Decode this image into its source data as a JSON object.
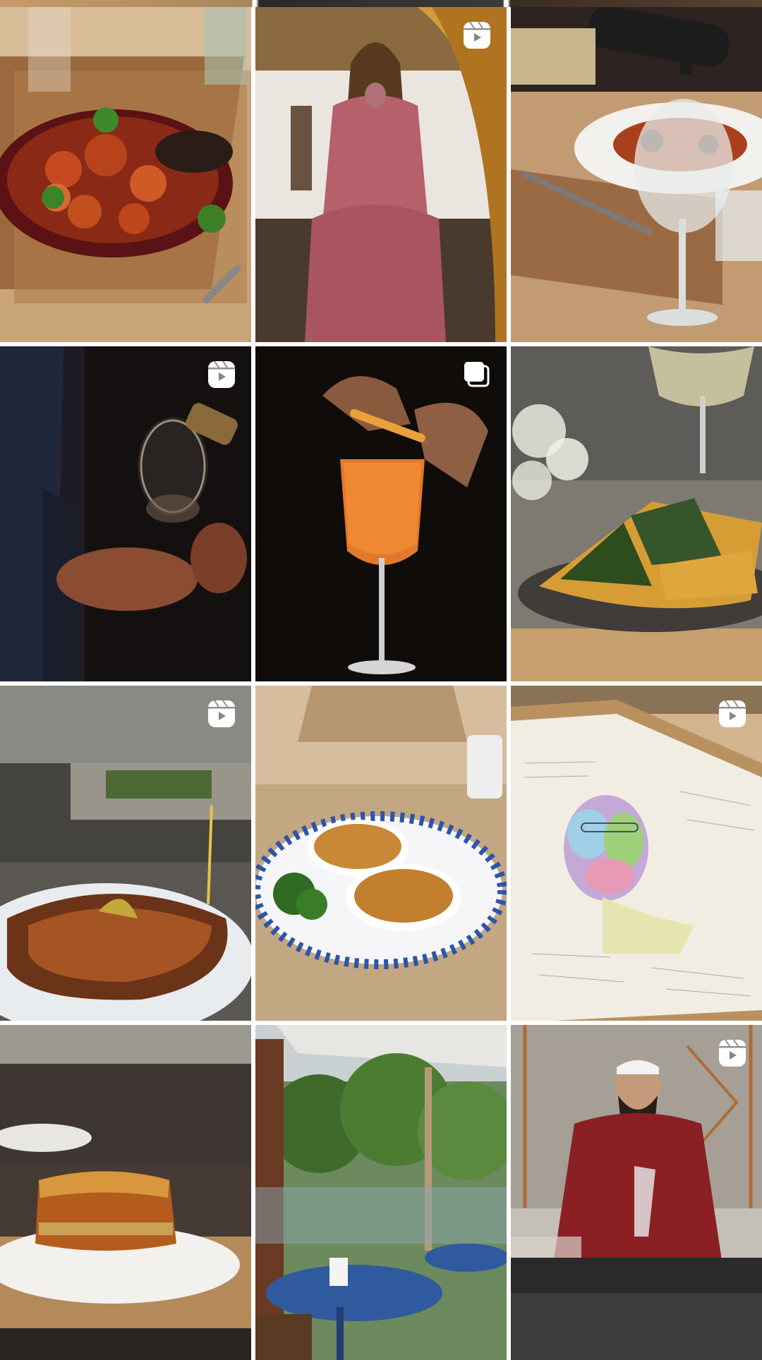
{
  "profile_grid": {
    "posts": [
      {
        "id": 1,
        "subject": "seafood-skillet",
        "type": "photo",
        "badge_icon": null
      },
      {
        "id": 2,
        "subject": "woman-pink-dress",
        "type": "reel",
        "badge_icon": "reel-icon"
      },
      {
        "id": 3,
        "subject": "wine-pour-pasta",
        "type": "photo",
        "badge_icon": null
      },
      {
        "id": 4,
        "subject": "wine-glass-pour",
        "type": "reel",
        "badge_icon": "reel-icon"
      },
      {
        "id": 5,
        "subject": "orange-spritz-cocktail",
        "type": "carousel",
        "badge_icon": "carousel-icon"
      },
      {
        "id": 6,
        "subject": "spinach-pie-wine",
        "type": "photo",
        "badge_icon": null
      },
      {
        "id": 7,
        "subject": "grilled-fish-olive-oil",
        "type": "reel",
        "badge_icon": "reel-icon"
      },
      {
        "id": 8,
        "subject": "gratin-ramekins",
        "type": "photo",
        "badge_icon": null
      },
      {
        "id": 9,
        "subject": "framed-portrait-drawing",
        "type": "reel",
        "badge_icon": "reel-icon"
      },
      {
        "id": 10,
        "subject": "moussaka-plate",
        "type": "photo",
        "badge_icon": null
      },
      {
        "id": 11,
        "subject": "outdoor-terrace",
        "type": "photo",
        "badge_icon": null
      },
      {
        "id": 12,
        "subject": "bartender-wine-glass",
        "type": "reel",
        "badge_icon": "reel-icon"
      }
    ],
    "colors": {
      "badge": "#ffffff",
      "background": "#ffffff"
    }
  }
}
